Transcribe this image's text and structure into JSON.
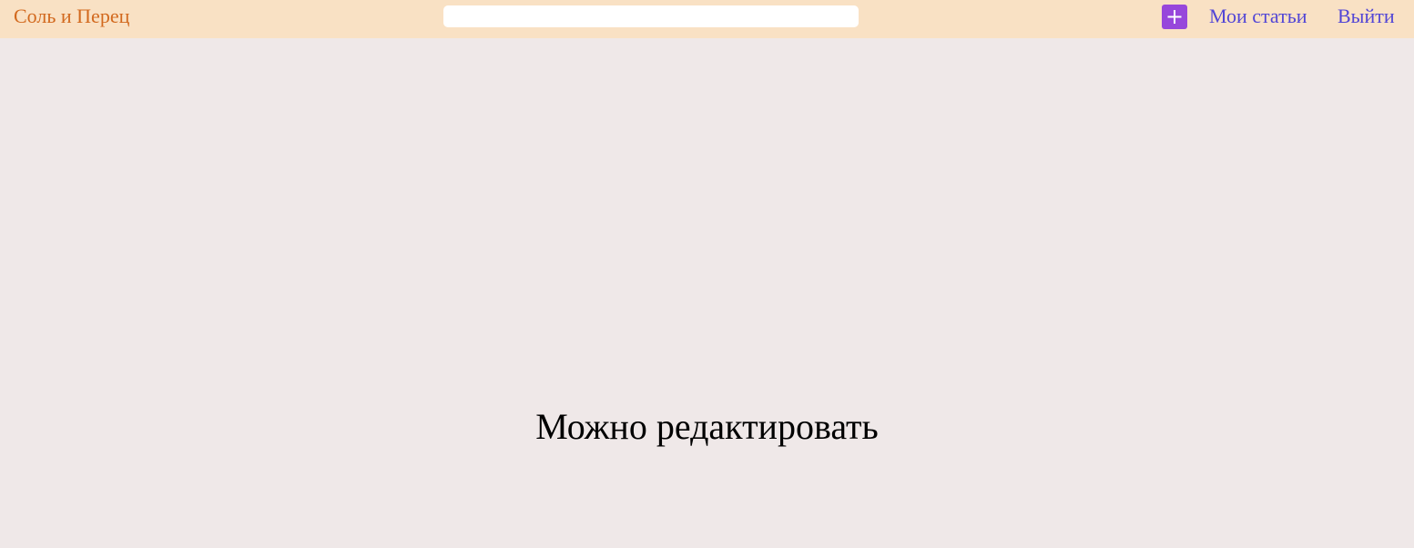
{
  "header": {
    "logo_text": "Соль и Перец",
    "search": {
      "value": "",
      "placeholder": ""
    },
    "add_icon": "plus-icon",
    "nav": {
      "my_articles": "Мои статьи",
      "logout": "Выйти"
    }
  },
  "main": {
    "message": "Можно редактировать"
  },
  "colors": {
    "header_bg": "#f9e1c4",
    "page_bg": "#efe8e8",
    "logo": "#d2691e",
    "link": "#5246d6",
    "add_button": "#9747db"
  }
}
